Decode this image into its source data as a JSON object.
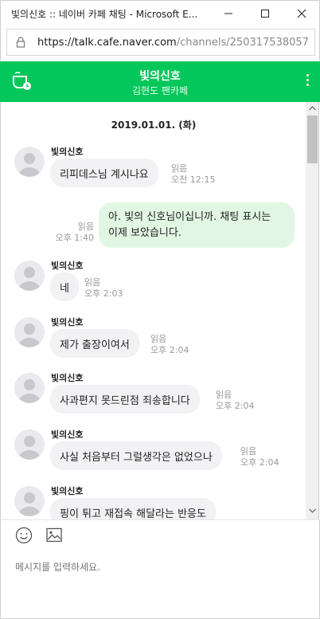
{
  "window": {
    "title": "빛의신호 :: 네이버 카페 채팅 - Microsoft E...",
    "minimize_icon": "minimize-icon",
    "maximize_icon": "maximize-icon",
    "close_icon": "close-icon"
  },
  "address_bar": {
    "host": "https://talk.cafe.naver.com",
    "path": "/channels/250317538057",
    "icon": "lock-icon"
  },
  "header": {
    "title": "빛의신호",
    "subtitle": "김현도 팬카페",
    "left_icon": "coffee-cup-icon",
    "right_icon": "more-vertical-icon",
    "color": "#03c75a"
  },
  "chat": {
    "date_separator": "2019.01.01. (화)",
    "messages": [
      {
        "sender": "빛의신호",
        "text": "리피데스님 계시나요",
        "read": "읽음",
        "time": "오전 12:15"
      },
      {
        "sender": "me",
        "text_line1": "아. 빛의 신호님이십니까. 채팅 표시는",
        "text_line2": "이제 보았습니다.",
        "read": "읽음",
        "time": "오후 1:40"
      },
      {
        "sender": "빛의신호",
        "text": "네",
        "read": "읽음",
        "time": "오후 2:03"
      },
      {
        "sender": "빛의신호",
        "text": "제가 출장이여서",
        "read": "읽음",
        "time": "오후 2:04"
      },
      {
        "sender": "빛의신호",
        "text": "사과편지 못드린점 죄송합니다",
        "read": "읽음",
        "time": "오후 2:04"
      },
      {
        "sender": "빛의신호",
        "text": "사실 처음부터 그럴생각은 없었으나",
        "read": "읽음",
        "time": "오후 2:04"
      },
      {
        "sender": "빛의신호",
        "text": "핑이 튀고 재접속 해달라는 반응도"
      }
    ],
    "bubble_color_mine": "#e1f7e3",
    "bubble_color_other": "#f2f2f4"
  },
  "composer": {
    "placeholder": "메시지를 입력하세요.",
    "emoji_icon": "emoji-icon",
    "image_icon": "image-icon"
  }
}
